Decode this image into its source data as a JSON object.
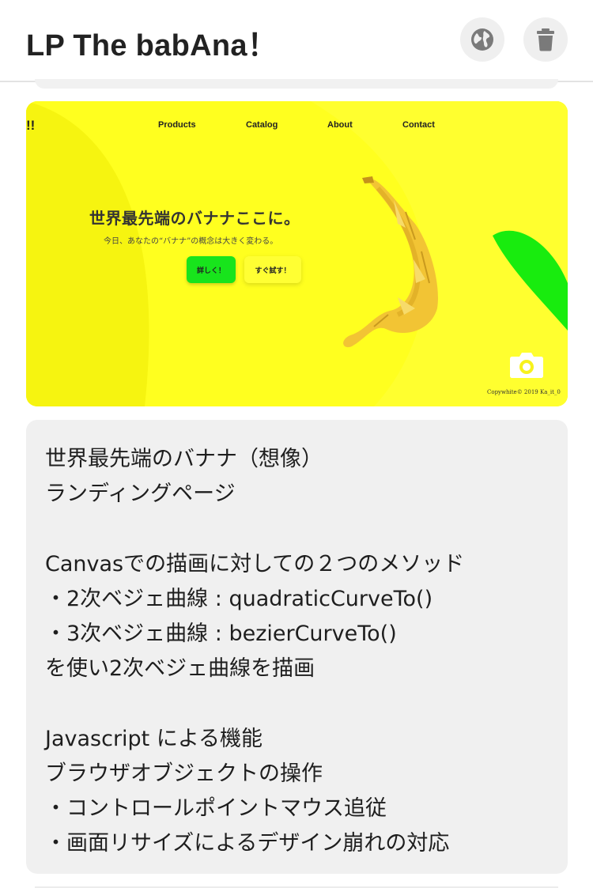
{
  "header": {
    "title": "LP The babAna！",
    "globe_icon": "globe-icon",
    "trash_icon": "trash-icon"
  },
  "preview": {
    "logo": "!!",
    "nav": [
      "Products",
      "Catalog",
      "About",
      "Contact"
    ],
    "headline": "世界最先端のバナナここに。",
    "subline": "今日、あなたの“バナナ”の概念は大きく変わる。",
    "button_details": "詳しく！",
    "button_try": "すぐ試す！",
    "copyright": "Copywhite© 2019 Ka_it_0",
    "camera_icon": "camera-icon",
    "colors": {
      "background": "#ffff1f",
      "accent_green": "#18e41c",
      "banana": "#f0c030"
    }
  },
  "description": {
    "text": "世界最先端のバナナ（想像）\nランディングページ\n\nCanvasでの描画に対しての２つのメソッド\n・2次ベジェ曲線 : quadraticCurveTo()\n・3次ベジェ曲線 : bezierCurveTo()\nを使い2次ベジェ曲線を描画\n\nJavascript による機能\nブラウザオブジェクトの操作\n・コントロールポイントマウス追従\n・画面リサイズによるデザイン崩れの対応"
  }
}
